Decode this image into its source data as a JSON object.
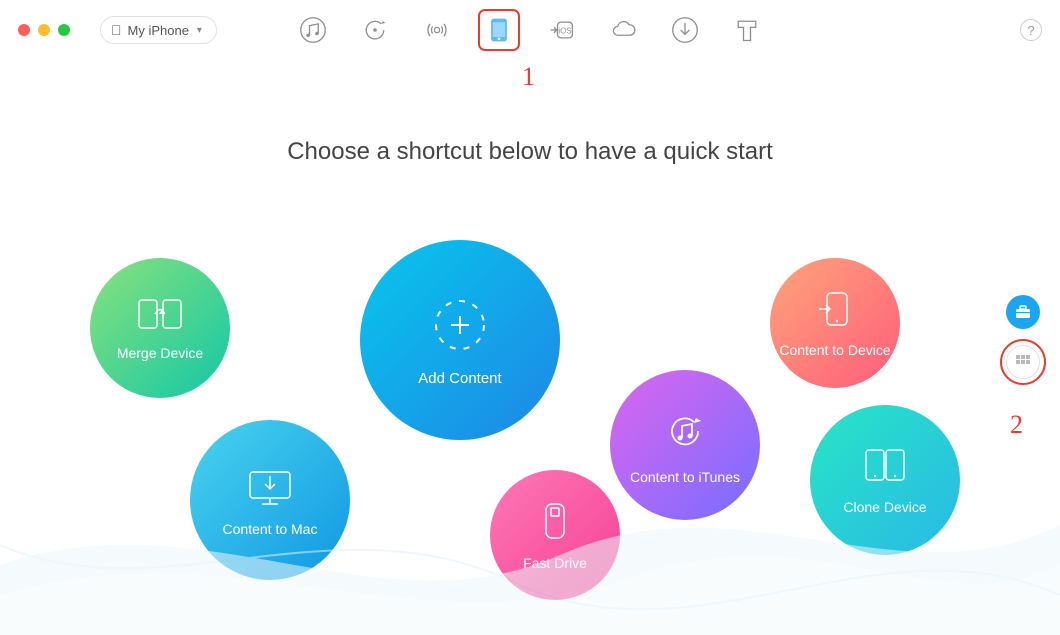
{
  "device_selector": {
    "label": "My iPhone"
  },
  "title": "Choose a shortcut below to have a quick start",
  "bubbles": {
    "merge": "Merge Device",
    "add": "Add Content",
    "c2d": "Content to Device",
    "c2mac": "Content to Mac",
    "fast": "Fast Drive",
    "c2it": "Content to iTunes",
    "clone": "Clone Device"
  },
  "annotations": {
    "step1": "1",
    "step2": "2"
  },
  "help": "?",
  "colors": {
    "annotation": "#e63e2e",
    "icon": "#8e8e8e"
  }
}
